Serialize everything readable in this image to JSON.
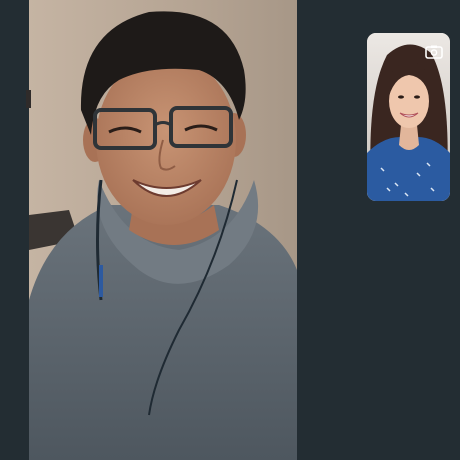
{
  "call": {
    "remote_participant_video": "remote-participant-feed",
    "self_view_video": "self-view-feed"
  },
  "icons": {
    "camera_switch": "camera-switch-icon"
  },
  "colors": {
    "background": "#232d33",
    "remote_wall": "#b8a797",
    "hoodie": "#5f6972",
    "self_view_blouse": "#2b5ba1"
  }
}
